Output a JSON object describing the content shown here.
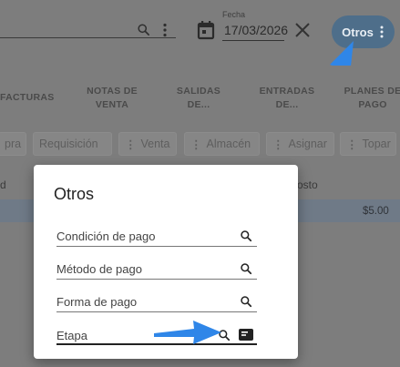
{
  "search": {
    "label": ""
  },
  "date": {
    "caption": "Fecha",
    "value": "17/03/2026"
  },
  "otros_button": {
    "label": "Otros"
  },
  "tabs": [
    {
      "label1": "FACTURAS",
      "label2": ""
    },
    {
      "label1": "NOTAS DE",
      "label2": "VENTA"
    },
    {
      "label1": "SALIDAS",
      "label2": "DE..."
    },
    {
      "label1": "ENTRADAS",
      "label2": "DE..."
    },
    {
      "label1": "PLANES DE",
      "label2": "PAGO"
    }
  ],
  "actions": [
    "pra",
    "Requisición",
    "Venta",
    "Almacén",
    "Asignar",
    "Topar"
  ],
  "table": {
    "col_left": "d",
    "col_right": "osto",
    "price": "$5.00"
  },
  "dialog": {
    "title": "Otros",
    "fields": [
      {
        "label": "Condición de pago"
      },
      {
        "label": "Método de pago"
      },
      {
        "label": "Forma de pago"
      },
      {
        "label": "Etapa"
      }
    ]
  },
  "icons": {
    "search": "search-icon",
    "menu": "vertical-dots-icon",
    "calendar": "calendar-icon",
    "clear": "close-icon",
    "card": "card-icon"
  },
  "colors": {
    "accent": "#4e6e8a",
    "highlight_arrow": "#2f86e8"
  }
}
